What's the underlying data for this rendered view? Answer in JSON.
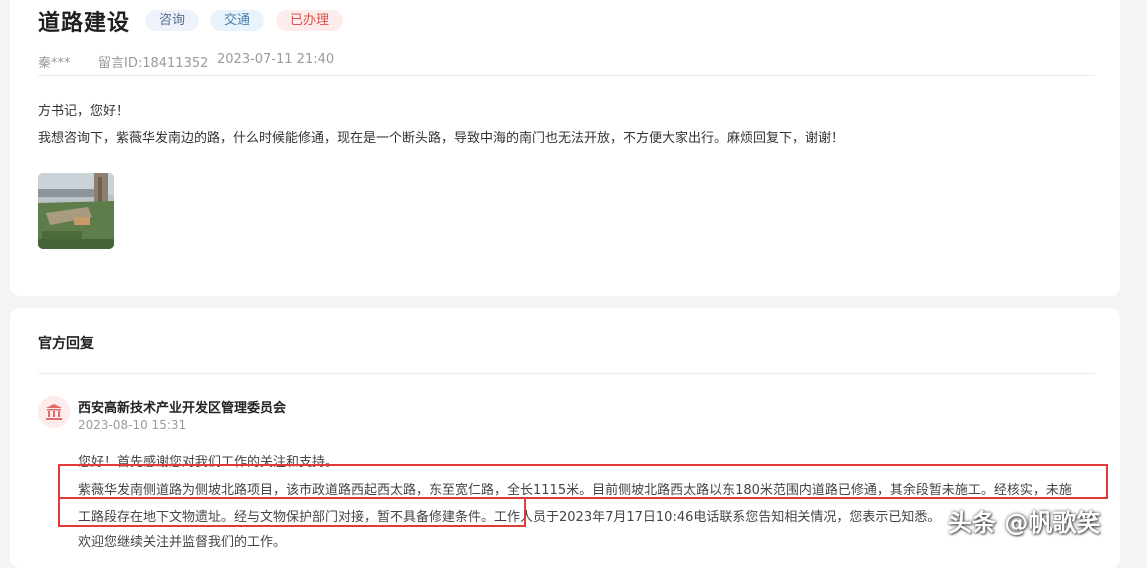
{
  "message": {
    "title": "道路建设",
    "tags": [
      "咨询",
      "交通",
      "已办理"
    ],
    "author": "秦***",
    "message_id": "留言ID:18411352",
    "timestamp": "2023-07-11 21:40",
    "greeting": "方书记，您好！",
    "content": "我想咨询下，紫薇华发南边的路，什么时候能修通，现在是一个断头路，导致中海的南门也无法开放，不方便大家出行。麻烦回复下，谢谢！"
  },
  "reply": {
    "section_title": "官方回复",
    "org_name": "西安高新技术产业开发区管理委员会",
    "date": "2023-08-10 15:31",
    "lines": [
      "您好！首先感谢您对我们工作的关注和支持。",
      "紫薇华发南侧道路为侧坡北路项目，该市政道路西起西太路，东至宽仁路，全长1115米。目前侧坡北路西太路以东180米范围内道路已修通，其余段暂未施工。经核实，未施",
      "工路段存在地下文物遗址。经与文物保护部门对接，暂不具备修建条件。工作人员于2023年7月17日10:46电话联系您告知相关情况，您表示已知悉。",
      "欢迎您继续关注并监督我们的工作。"
    ]
  },
  "watermark": "头条 @帆歌笑",
  "colors": {
    "tag_done": "#d9534f",
    "highlight": "#e03a3a"
  }
}
